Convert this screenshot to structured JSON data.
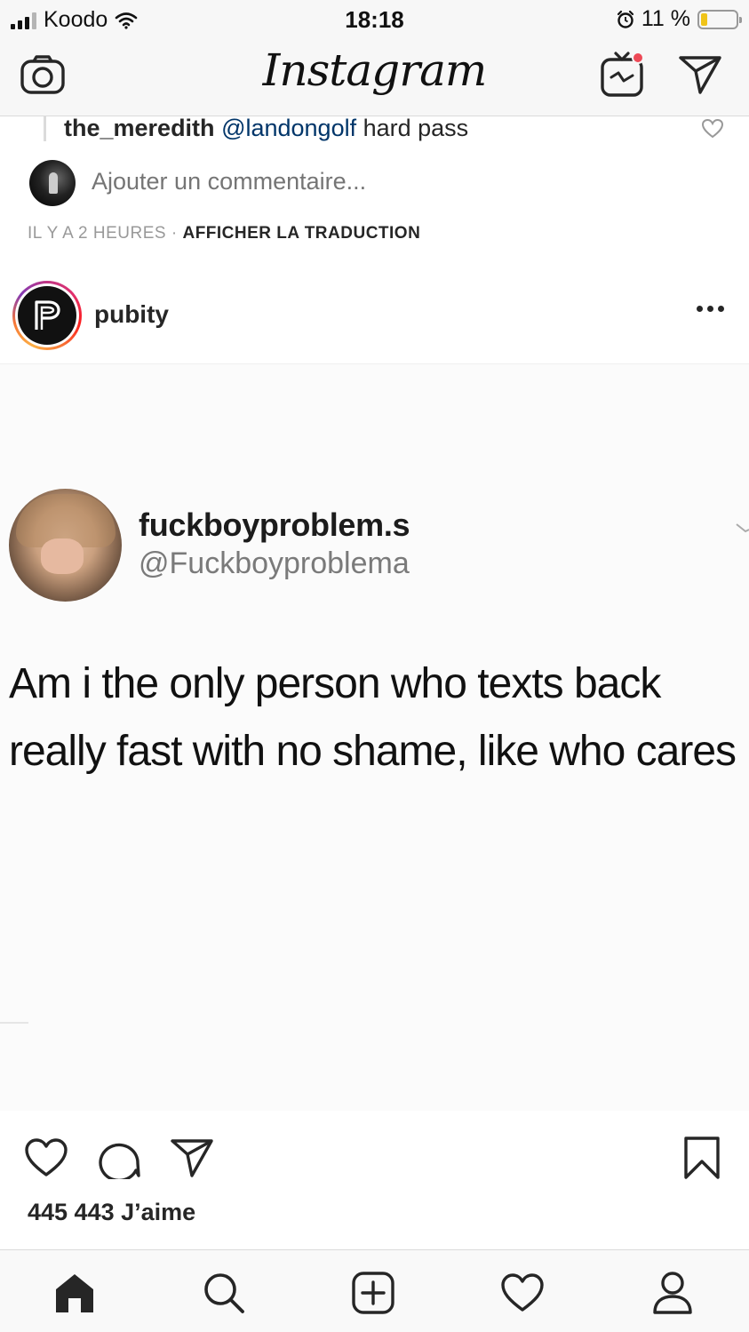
{
  "status_bar": {
    "carrier": "Koodo",
    "time": "18:18",
    "battery_percent": "11 %",
    "battery_level": 0.11
  },
  "top_nav": {
    "logo": "Instagram",
    "icons": [
      "camera-icon",
      "igtv-icon",
      "direct-icon"
    ]
  },
  "comments": {
    "reply": {
      "user": "the_meredith",
      "mention": "@landongolf",
      "text": " hard pass"
    },
    "add_comment_placeholder": "Ajouter un commentaire...",
    "timestamp": "IL Y A 2 HEURES",
    "separator": " · ",
    "translate_label": "AFFICHER LA TRADUCTION"
  },
  "post": {
    "username": "pubity",
    "tweet": {
      "display_name": "fuckboyproblem.s",
      "handle": "@Fuckboyproblema",
      "text": "Am i the only person who texts back really fast with no shame, like who cares"
    },
    "likes": "445 443 J’aime"
  },
  "bottom_nav": {
    "tabs": [
      "home-icon",
      "search-icon",
      "new-post-icon",
      "activity-icon",
      "profile-icon"
    ]
  },
  "colors": {
    "text": "#262626",
    "muted": "#999999",
    "mention": "#003569",
    "notification_dot": "#ed4956",
    "battery_fill": "#f0c419"
  }
}
